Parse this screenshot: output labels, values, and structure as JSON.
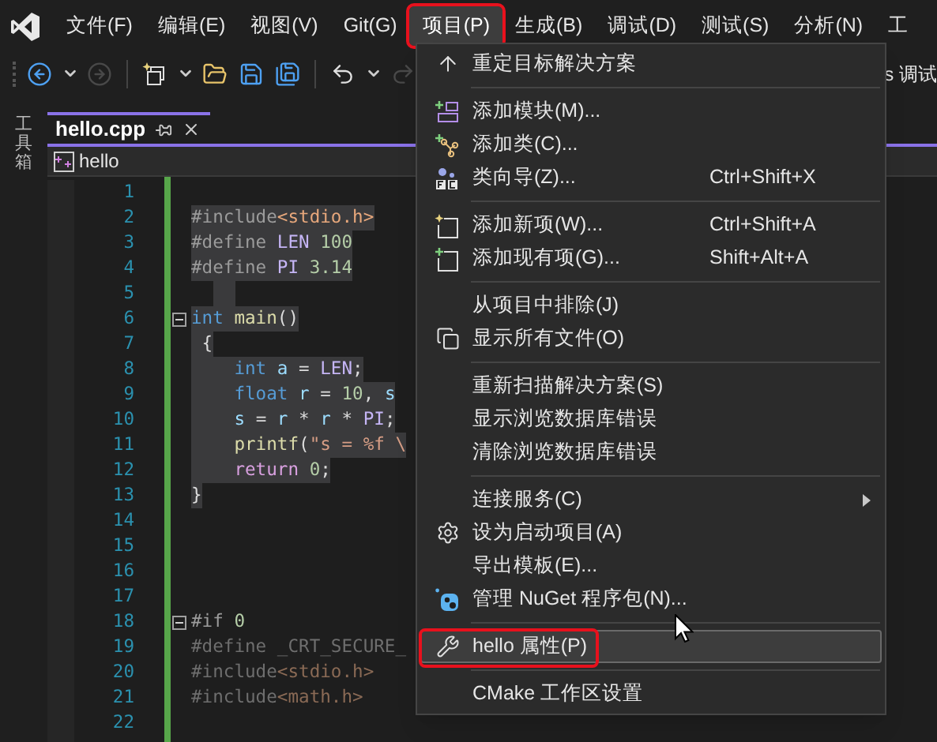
{
  "menu_bar": [
    {
      "label": "文件(F)",
      "selected": false
    },
    {
      "label": "编辑(E)",
      "selected": false
    },
    {
      "label": "视图(V)",
      "selected": false
    },
    {
      "label": "Git(G)",
      "selected": false
    },
    {
      "label": "项目(P)",
      "selected": true
    },
    {
      "label": "生成(B)",
      "selected": false
    },
    {
      "label": "调试(D)",
      "selected": false
    },
    {
      "label": "测试(S)",
      "selected": false
    },
    {
      "label": "分析(N)",
      "selected": false
    },
    {
      "label": "工",
      "selected": false
    }
  ],
  "toolbar": {
    "trailing_text": "s 调试"
  },
  "side_strip": {
    "label": "工具箱"
  },
  "tabs": [
    {
      "label": "hello.cpp",
      "selected": true
    }
  ],
  "breadcrumb": {
    "label": "hello"
  },
  "code_lines": [
    {
      "number": "1",
      "selected": false,
      "fold": false
    },
    {
      "number": "2",
      "selected": true,
      "fold": false,
      "tokens": [
        {
          "t": "#include",
          "kind": "pp"
        },
        {
          "t": "<stdio.h>",
          "kind": "hdr"
        }
      ]
    },
    {
      "number": "3",
      "selected": true,
      "fold": false,
      "tokens": [
        {
          "t": "#define ",
          "kind": "pp"
        },
        {
          "t": "LEN",
          "kind": "macro"
        },
        {
          "t": " 100",
          "kind": "num"
        }
      ]
    },
    {
      "number": "4",
      "selected": true,
      "fold": false,
      "tokens": [
        {
          "t": "#define ",
          "kind": "pp"
        },
        {
          "t": "PI",
          "kind": "macro"
        },
        {
          "t": " 3.14",
          "kind": "num"
        }
      ]
    },
    {
      "number": "5",
      "selected": true,
      "fold": false
    },
    {
      "number": "6",
      "selected": true,
      "fold": true,
      "tokens": [
        {
          "t": "int",
          "kind": "kw"
        },
        {
          "t": " main",
          "kind": "fn"
        },
        {
          "t": "()",
          "kind": "op"
        }
      ]
    },
    {
      "number": "7",
      "selected": true,
      "fold": false,
      "tokens": [
        {
          "t": " {",
          "kind": "op"
        }
      ]
    },
    {
      "number": "8",
      "selected": true,
      "fold": false,
      "tokens": [
        {
          "t": "    int",
          "kind": "kw"
        },
        {
          "t": " a",
          "kind": "var"
        },
        {
          "t": " = ",
          "kind": "op"
        },
        {
          "t": "LEN",
          "kind": "macro"
        },
        {
          "t": ";",
          "kind": "op"
        }
      ]
    },
    {
      "number": "9",
      "selected": true,
      "fold": false,
      "tokens": [
        {
          "t": "    float",
          "kind": "kw"
        },
        {
          "t": " r",
          "kind": "var"
        },
        {
          "t": " = ",
          "kind": "op"
        },
        {
          "t": "10",
          "kind": "num"
        },
        {
          "t": ", ",
          "kind": "op"
        },
        {
          "t": "s",
          "kind": "var"
        }
      ]
    },
    {
      "number": "10",
      "selected": true,
      "fold": false,
      "tokens": [
        {
          "t": "    s",
          "kind": "var"
        },
        {
          "t": " = ",
          "kind": "op"
        },
        {
          "t": "r",
          "kind": "var"
        },
        {
          "t": " * ",
          "kind": "op"
        },
        {
          "t": "r",
          "kind": "var"
        },
        {
          "t": " * ",
          "kind": "op"
        },
        {
          "t": "PI",
          "kind": "macro"
        },
        {
          "t": ";",
          "kind": "op"
        }
      ]
    },
    {
      "number": "11",
      "selected": true,
      "fold": false,
      "tokens": [
        {
          "t": "    printf",
          "kind": "fn"
        },
        {
          "t": "(",
          "kind": "op"
        },
        {
          "t": "\"s = %f \\",
          "kind": "str"
        }
      ]
    },
    {
      "number": "12",
      "selected": true,
      "fold": false,
      "tokens": [
        {
          "t": "    return",
          "kind": "ctrl"
        },
        {
          "t": " 0",
          "kind": "num"
        },
        {
          "t": ";",
          "kind": "op"
        }
      ]
    },
    {
      "number": "13",
      "selected": true,
      "fold": false,
      "tokens": [
        {
          "t": "}",
          "kind": "op"
        }
      ]
    },
    {
      "number": "14",
      "selected": false,
      "fold": false
    },
    {
      "number": "15",
      "selected": false,
      "fold": false
    },
    {
      "number": "16",
      "selected": false,
      "fold": false
    },
    {
      "number": "17",
      "selected": false,
      "fold": false
    },
    {
      "number": "18",
      "selected": false,
      "fold": true,
      "tokens": [
        {
          "t": "#if",
          "kind": "pp"
        },
        {
          "t": " 0",
          "kind": "num"
        }
      ]
    },
    {
      "number": "19",
      "selected": false,
      "fold": false,
      "tokens": [
        {
          "t": "#define _CRT_SECURE_",
          "kind": "dim"
        }
      ]
    },
    {
      "number": "20",
      "selected": false,
      "fold": false,
      "tokens": [
        {
          "t": "#include",
          "kind": "dim"
        },
        {
          "t": "<stdio.h>",
          "kind": "dimhdr"
        }
      ]
    },
    {
      "number": "21",
      "selected": false,
      "fold": false,
      "tokens": [
        {
          "t": "#include",
          "kind": "dim"
        },
        {
          "t": "<math.h>",
          "kind": "dimhdr"
        }
      ]
    },
    {
      "number": "22",
      "selected": false,
      "fold": false
    }
  ],
  "project_menu": [
    {
      "kind": "item",
      "label": "重定目标解决方案",
      "submenu": false,
      "selected": false
    },
    {
      "kind": "separator"
    },
    {
      "kind": "item",
      "label": "添加模块(M)...",
      "submenu": false,
      "selected": false
    },
    {
      "kind": "item",
      "label": "添加类(C)...",
      "submenu": false,
      "selected": false
    },
    {
      "kind": "item",
      "label": "类向导(Z)...",
      "shortcut": "Ctrl+Shift+X",
      "submenu": false,
      "selected": false
    },
    {
      "kind": "separator"
    },
    {
      "kind": "item",
      "label": "添加新项(W)...",
      "shortcut": "Ctrl+Shift+A",
      "submenu": false,
      "selected": false
    },
    {
      "kind": "item",
      "label": "添加现有项(G)...",
      "shortcut": "Shift+Alt+A",
      "submenu": false,
      "selected": false
    },
    {
      "kind": "separator"
    },
    {
      "kind": "item",
      "label": "从项目中排除(J)",
      "submenu": false,
      "selected": false
    },
    {
      "kind": "item",
      "label": "显示所有文件(O)",
      "submenu": false,
      "selected": false
    },
    {
      "kind": "separator"
    },
    {
      "kind": "item",
      "label": "重新扫描解决方案(S)",
      "submenu": false,
      "selected": false
    },
    {
      "kind": "item",
      "label": "显示浏览数据库错误",
      "submenu": false,
      "selected": false
    },
    {
      "kind": "item",
      "label": "清除浏览数据库错误",
      "submenu": false,
      "selected": false
    },
    {
      "kind": "separator"
    },
    {
      "kind": "item",
      "label": "连接服务(C)",
      "submenu": true,
      "selected": false
    },
    {
      "kind": "item",
      "label": "设为启动项目(A)",
      "submenu": false,
      "selected": false
    },
    {
      "kind": "item",
      "label": "导出模板(E)...",
      "submenu": false,
      "selected": false
    },
    {
      "kind": "item",
      "label": "管理 NuGet 程序包(N)...",
      "submenu": false,
      "selected": false
    },
    {
      "kind": "separator"
    },
    {
      "kind": "item",
      "label": "hello 属性(P)",
      "submenu": false,
      "selected": true
    },
    {
      "kind": "separator"
    },
    {
      "kind": "item",
      "label": "CMake 工作区设置",
      "submenu": false,
      "selected": false
    }
  ]
}
